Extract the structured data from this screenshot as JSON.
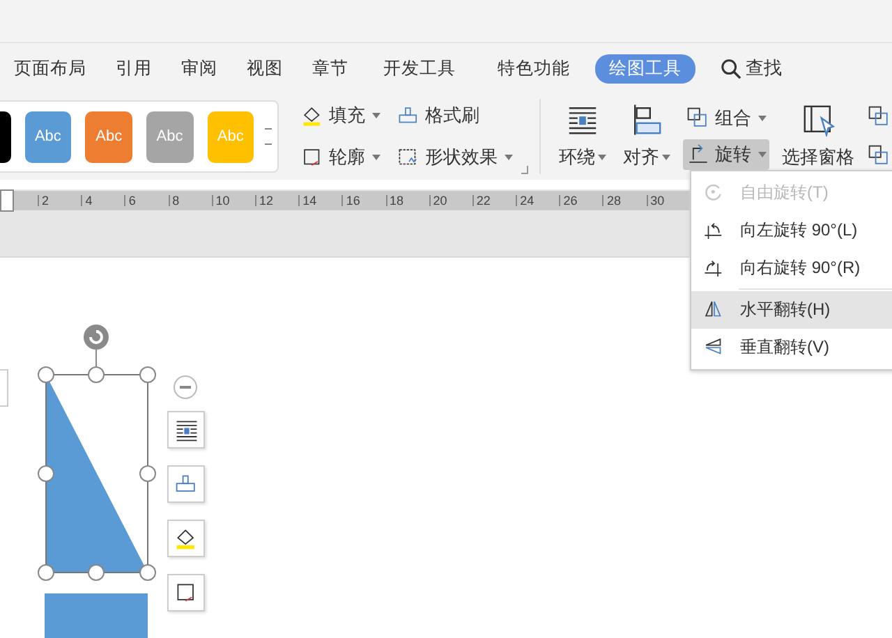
{
  "tabs": [
    {
      "label": "页面布局",
      "selected": false
    },
    {
      "label": "引用",
      "selected": false
    },
    {
      "label": "审阅",
      "selected": false
    },
    {
      "label": "视图",
      "selected": false
    },
    {
      "label": "章节",
      "selected": false
    },
    {
      "label": "开发工具",
      "selected": false
    },
    {
      "label": "特色功能",
      "selected": false
    },
    {
      "label": "绘图工具",
      "selected": true
    }
  ],
  "search": {
    "label": "查找"
  },
  "style_gallery": [
    {
      "color": "#000000"
    },
    {
      "label": "Abc",
      "color": "#5b9bd5"
    },
    {
      "label": "Abc",
      "color": "#ed7d31"
    },
    {
      "label": "Abc",
      "color": "#a5a5a5"
    },
    {
      "label": "Abc",
      "color": "#ffc000"
    }
  ],
  "format_buttons": [
    {
      "kind": "fill",
      "label": "填充",
      "dropdown": true
    },
    {
      "kind": "format-painter",
      "label": "格式刷",
      "dropdown": false
    },
    {
      "kind": "outline",
      "label": "轮廓",
      "dropdown": true
    },
    {
      "kind": "shape-effects",
      "label": "形状效果",
      "dropdown": true
    }
  ],
  "arrange_buttons": [
    {
      "kind": "wrap",
      "label": "环绕",
      "dropdown": true,
      "pressed": false
    },
    {
      "kind": "align",
      "label": "对齐",
      "dropdown": true,
      "pressed": false
    },
    {
      "kind": "group",
      "label": "组合",
      "dropdown": true,
      "pressed": false
    },
    {
      "kind": "rotate",
      "label": "旋转",
      "dropdown": true,
      "pressed": true
    },
    {
      "kind": "selection-pane",
      "label": "选择窗格",
      "dropdown": false,
      "pressed": false
    }
  ],
  "ruler": {
    "labels": [
      "2",
      "4",
      "6",
      "8",
      "10",
      "12",
      "14",
      "16",
      "18",
      "20",
      "22",
      "24",
      "26",
      "28",
      "30"
    ]
  },
  "rotate_menu": [
    {
      "kind": "free-rotate",
      "label": "自由旋转(T)",
      "disabled": true,
      "selected": false
    },
    {
      "kind": "rotate-left",
      "label": "向左旋转 90°(L)",
      "disabled": false,
      "selected": false
    },
    {
      "kind": "rotate-right",
      "label": "向右旋转 90°(R)",
      "disabled": false,
      "selected": false
    },
    {
      "kind": "flip-horizontal",
      "label": "水平翻转(H)",
      "disabled": false,
      "selected": true
    },
    {
      "kind": "flip-vertical",
      "label": "垂直翻转(V)",
      "disabled": false,
      "selected": false
    }
  ]
}
